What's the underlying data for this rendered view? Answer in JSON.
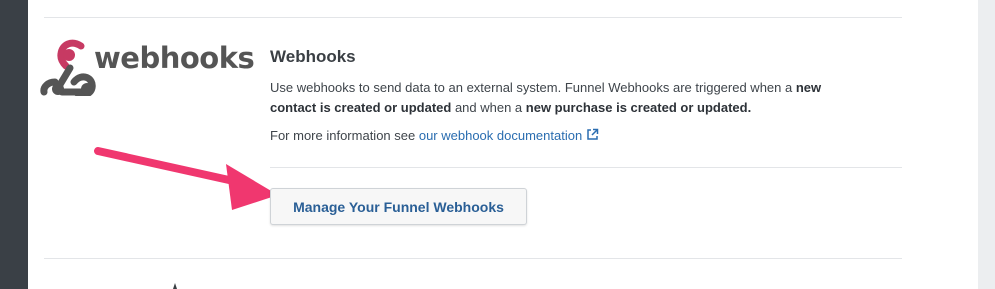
{
  "logo": {
    "icon": "webhooks-logo-icon",
    "text": "webhooks"
  },
  "section": {
    "title": "Webhooks",
    "description": {
      "part1": "Use webhooks to send data to an external system. Funnel Webhooks are triggered when a ",
      "bold1": "new contact is created or updated",
      "part2": " and when a ",
      "bold2": "new purchase is created or updated.",
      "part3": ""
    },
    "more_info_prefix": "For more information see ",
    "more_info_link": "our webhook documentation",
    "more_info_icon": "external-link-icon"
  },
  "actions": {
    "manage_label": "Manage Your Funnel Webhooks"
  },
  "annotation": {
    "arrow_color": "#f0376f"
  },
  "colors": {
    "link": "#2a6db0",
    "button_text": "#2a5f96",
    "logo_pink": "#c73a63",
    "logo_gray": "#555555"
  }
}
